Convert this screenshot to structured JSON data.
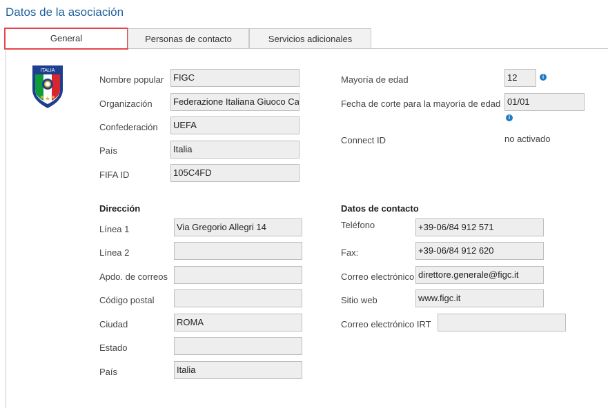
{
  "page": {
    "title": "Datos de la asociación"
  },
  "tabs": [
    {
      "label": "General"
    },
    {
      "label": "Personas de contacto"
    },
    {
      "label": "Servicios adicionales"
    }
  ],
  "crest": {
    "text": "ITALIA",
    "colors": {
      "shield": "#1d3f8f",
      "green": "#0f9b3b",
      "red": "#d7262d",
      "gold": "#e4b43a"
    }
  },
  "general": {
    "nombre_popular": {
      "label": "Nombre popular",
      "value": "FIGC"
    },
    "organizacion": {
      "label": "Organización",
      "value": "Federazione Italiana Giuoco Calcio"
    },
    "confederacion": {
      "label": "Confederación",
      "value": "UEFA"
    },
    "pais": {
      "label": "País",
      "value": "Italia"
    },
    "fifa_id": {
      "label": "FIFA ID",
      "value": "105C4FD"
    }
  },
  "right": {
    "mayoria": {
      "label": "Mayoría de edad",
      "value": "12"
    },
    "fecha_corte": {
      "label": "Fecha de corte para la mayoría de edad",
      "value": "01/01"
    },
    "connect_id": {
      "label": "Connect ID",
      "value": "no activado"
    }
  },
  "direccion": {
    "heading": "Dirección",
    "linea1": {
      "label": "Línea 1",
      "value": "Via Gregorio Allegri 14"
    },
    "linea2": {
      "label": "Línea 2",
      "value": ""
    },
    "apdo": {
      "label": "Apdo. de correos",
      "value": ""
    },
    "codigo_postal": {
      "label": "Código postal",
      "value": ""
    },
    "ciudad": {
      "label": "Ciudad",
      "value": "ROMA"
    },
    "estado": {
      "label": "Estado",
      "value": ""
    },
    "pais": {
      "label": "País",
      "value": "Italia"
    }
  },
  "contacto": {
    "heading": "Datos de contacto",
    "telefono": {
      "label": "Teléfono",
      "value": "+39-06/84 912 571"
    },
    "fax": {
      "label": "Fax:",
      "value": "+39-06/84 912 620"
    },
    "correo": {
      "label": "Correo electrónico",
      "value": "direttore.generale@figc.it"
    },
    "web": {
      "label": "Sitio web",
      "value": "www.figc.it"
    },
    "correo_irt": {
      "label": "Correo electrónico IRT",
      "value": ""
    }
  },
  "info_icon_glyph": "i"
}
